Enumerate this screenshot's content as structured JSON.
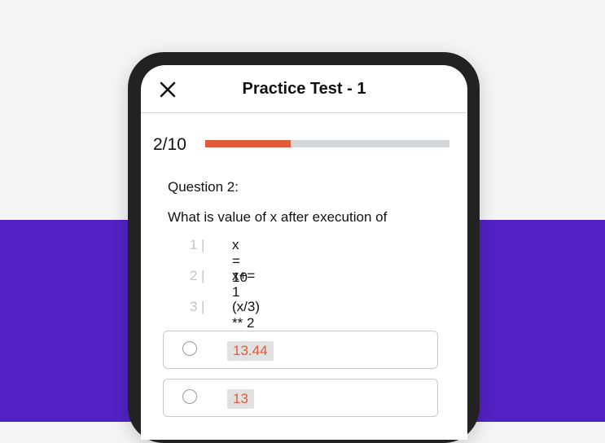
{
  "header": {
    "title": "Practice Test - 1",
    "close_icon": "close-icon"
  },
  "progress": {
    "text": "2/10",
    "current": 2,
    "total": 10,
    "fill_fraction": 0.35,
    "fill_color": "#e05b3c",
    "track_color": "#d4d7da"
  },
  "question": {
    "label": "Question 2:",
    "text": "What is value of x after execution of",
    "code": [
      {
        "num": "1",
        "code": "x = 10"
      },
      {
        "num": "2",
        "code": "x+= 1"
      },
      {
        "num": "3",
        "code": "(x/3) ** 2"
      }
    ]
  },
  "options": [
    {
      "label": "13.44"
    },
    {
      "label": "13"
    }
  ],
  "colors": {
    "background_top": "#f4f5f7",
    "background_bottom": "#5222c4",
    "phone_frame": "#222222",
    "accent": "#e05b3c"
  }
}
